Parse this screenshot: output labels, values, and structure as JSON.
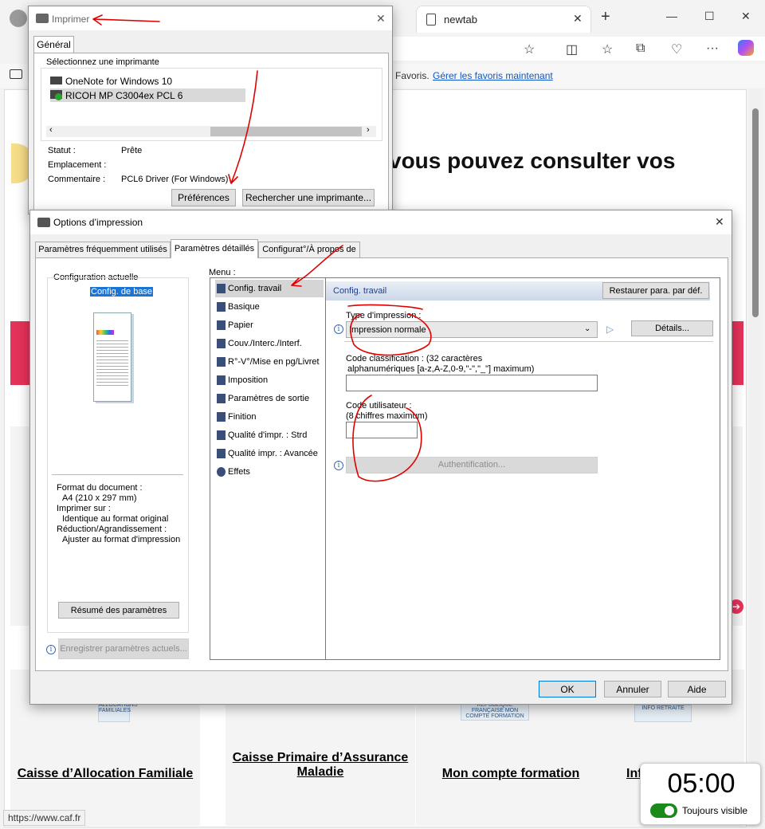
{
  "browser": {
    "tab_title": "newtab",
    "favorites_text": "Favoris.",
    "favorites_link": "Gérer les favoris maintenant",
    "status_url": "https://www.caf.fr"
  },
  "page": {
    "heading": "vous pouvez consulter vos",
    "cards": [
      {
        "label": "Caisse d’Allocation Familiale"
      },
      {
        "label": "Caisse Primaire d’Assurance Maladie"
      },
      {
        "label": "Mon compte formation"
      },
      {
        "label": "Inf"
      }
    ],
    "logos": {
      "caf": "ALLOCATIONS FAMILIALES",
      "mcf": "RÉPUBLIQUE FRANÇAISE MON COMPTE FORMATION",
      "retraite": "INFO RETRAITE"
    }
  },
  "timer": {
    "time": "05:00",
    "toggle_label": "Toujours visible"
  },
  "print_dialog": {
    "title": "Imprimer",
    "tab": "Général",
    "group": "Sélectionnez une imprimante",
    "printers": [
      "OneNote for Windows 10",
      "RICOH MP C3004ex PCL 6"
    ],
    "status_label": "Statut :",
    "status_value": "Prête",
    "location_label": "Emplacement :",
    "location_value": "",
    "comment_label": "Commentaire :",
    "comment_value": "PCL6 Driver (For Windows)",
    "preferences_button": "Préférences",
    "find_printer_button": "Rechercher une imprimante..."
  },
  "options_dialog": {
    "title": "Options d’impression",
    "tabs": [
      "Paramètres fréquemment utilisés",
      "Paramètres détaillés",
      "Configurat°/À propos de"
    ],
    "current_config_label": "Configuration actuelle",
    "current_config_value": "Config. de base",
    "summary": [
      "Format du document :",
      "A4 (210 x 297 mm)",
      "Imprimer sur :",
      "Identique au format original",
      "Réduction/Agrandissement :",
      "Ajuster au format d'impression"
    ],
    "summary_button": "Résumé des paramètres",
    "save_button": "Enregistrer paramètres actuels...",
    "menu_label": "Menu :",
    "menu": [
      "Config. travail",
      "Basique",
      "Papier",
      "Couv./Interc./Interf.",
      "R°-V°/Mise en pg/Livret",
      "Imposition",
      "Paramètres de sortie",
      "Finition",
      "Qualité d'impr. : Strd",
      "Qualité impr. : Avancée",
      "Effets"
    ],
    "panel_title": "Config. travail",
    "restore_button": "Restaurer para. par déf.",
    "print_type_label": "Type d'impression :",
    "print_type_value": "Impression normale",
    "details_button": "Détails...",
    "classification_label_1": "Code classification : (32 caractères",
    "classification_label_2": "alphanumériques [a-z,A-Z,0-9,\"-\",\"_\"] maximum)",
    "classification_value": "",
    "user_code_label_1": "Code utilisateur :",
    "user_code_label_2": "(8 chiffres maximum)",
    "user_code_value": "",
    "auth_button": "Authentification...",
    "ok": "OK",
    "cancel": "Annuler",
    "help": "Aide"
  },
  "colors": {
    "accent_pink": "#e5325a",
    "link_blue": "#0b57d0",
    "annotation_red": "#e00000",
    "panel_title_blue": "#1f3f8f"
  }
}
